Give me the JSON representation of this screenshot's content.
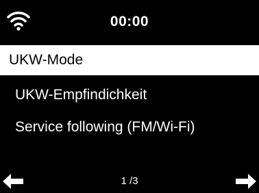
{
  "status": {
    "time": "00:00",
    "wifi_icon": "wifi-icon"
  },
  "menu": {
    "items": [
      {
        "label": "UKW-Mode",
        "selected": true
      },
      {
        "label": "UKW-Empfindichkeit",
        "selected": false
      },
      {
        "label": "Service following (FM/Wi-Fi)",
        "selected": false
      }
    ]
  },
  "footer": {
    "page": "1 /3",
    "left_icon": "arrow-left-icon",
    "right_icon": "arrow-right-icon"
  },
  "colors": {
    "background": "#000000",
    "foreground": "#ffffff",
    "highlight": "#ffffff"
  }
}
